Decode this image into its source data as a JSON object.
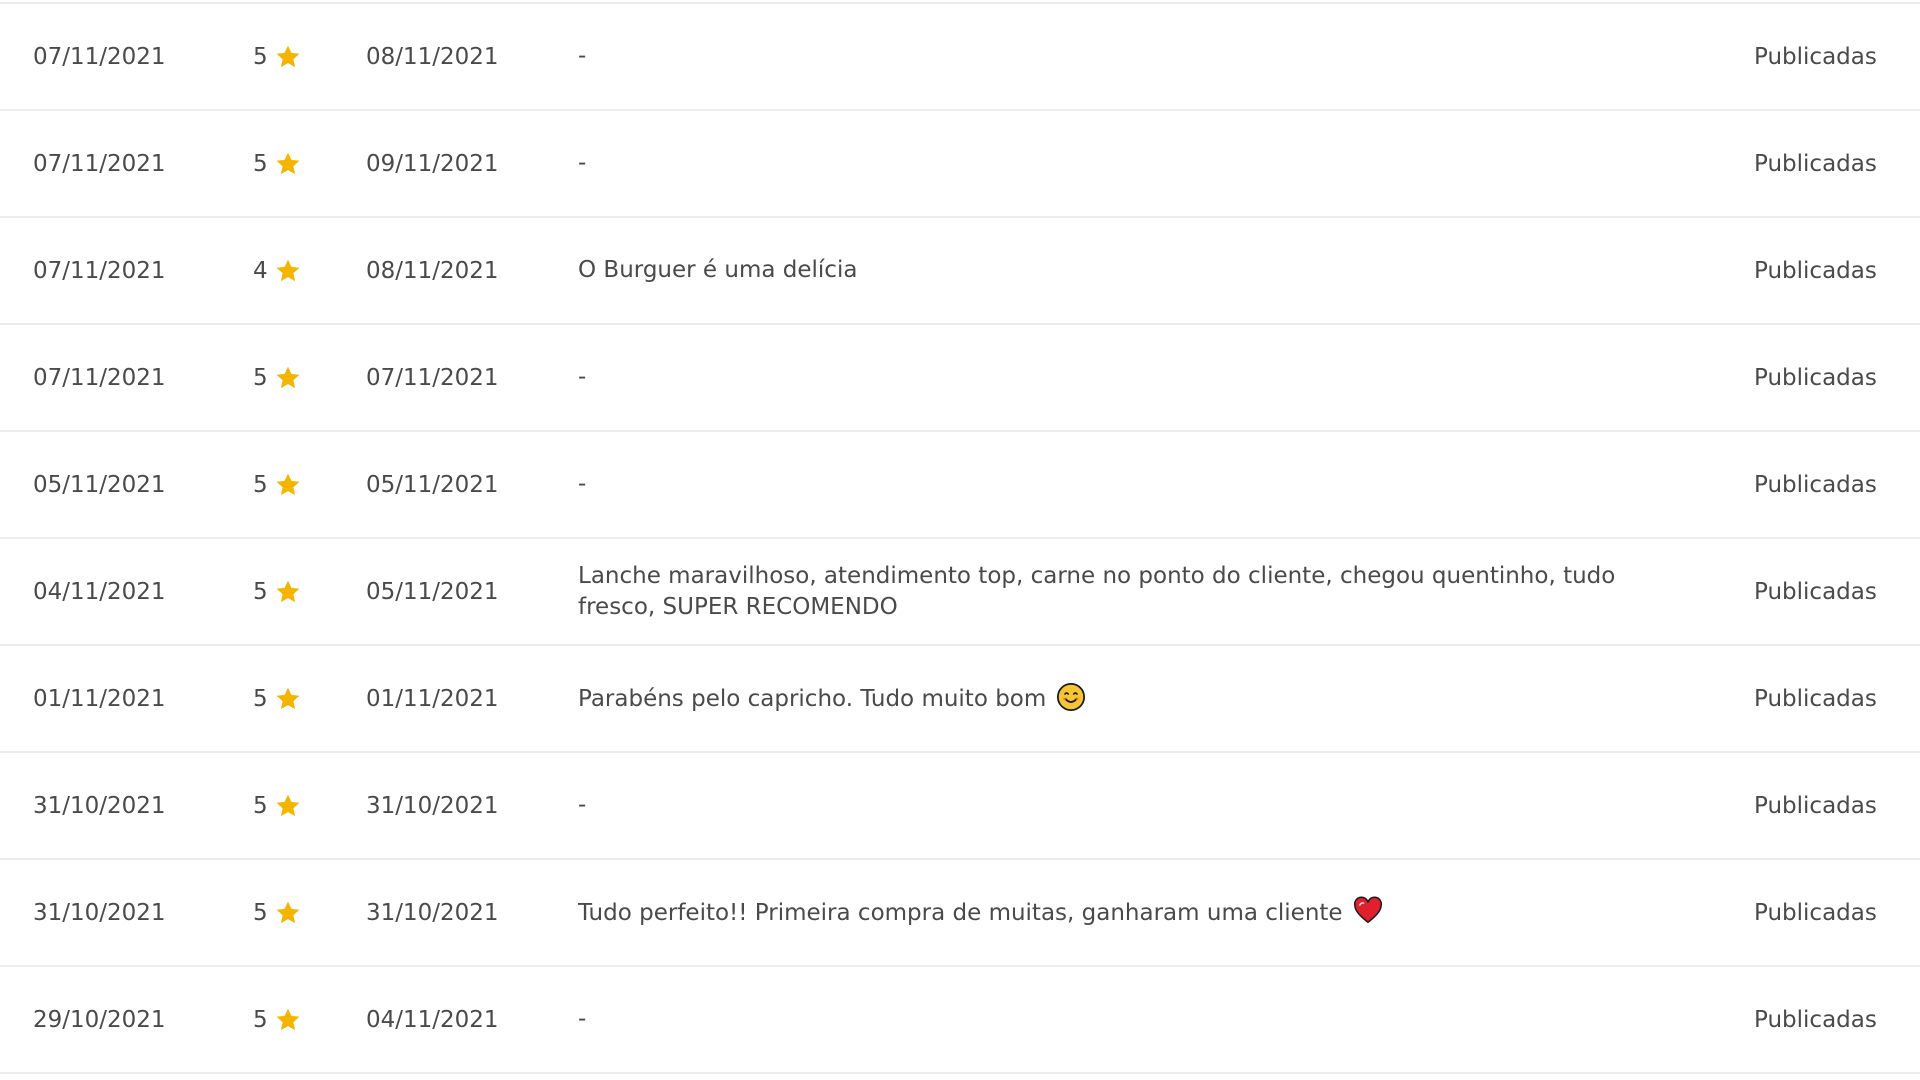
{
  "reviews": [
    {
      "date": "07/11/2021",
      "rating": "5",
      "reply_date": "08/11/2021",
      "comment": "-",
      "status": "Publicadas"
    },
    {
      "date": "07/11/2021",
      "rating": "5",
      "reply_date": "09/11/2021",
      "comment": "-",
      "status": "Publicadas"
    },
    {
      "date": "07/11/2021",
      "rating": "4",
      "reply_date": "08/11/2021",
      "comment": "O Burguer é uma delícia",
      "status": "Publicadas"
    },
    {
      "date": "07/11/2021",
      "rating": "5",
      "reply_date": "07/11/2021",
      "comment": "-",
      "status": "Publicadas"
    },
    {
      "date": "05/11/2021",
      "rating": "5",
      "reply_date": "05/11/2021",
      "comment": "-",
      "status": "Publicadas"
    },
    {
      "date": "04/11/2021",
      "rating": "5",
      "reply_date": "05/11/2021",
      "comment": "Lanche maravilhoso, atendimento top, carne no ponto do cliente, chegou quentinho, tudo fresco, SUPER RECOMENDO",
      "status": "Publicadas"
    },
    {
      "date": "01/11/2021",
      "rating": "5",
      "reply_date": "01/11/2021",
      "comment": "Parabéns pelo capricho. Tudo muito bom",
      "comment_emoji": "smiling-face-icon",
      "status": "Publicadas"
    },
    {
      "date": "31/10/2021",
      "rating": "5",
      "reply_date": "31/10/2021",
      "comment": "-",
      "status": "Publicadas"
    },
    {
      "date": "31/10/2021",
      "rating": "5",
      "reply_date": "31/10/2021",
      "comment": "Tudo perfeito!! Primeira compra de muitas, ganharam uma cliente",
      "comment_emoji": "red-heart-icon",
      "status": "Publicadas"
    },
    {
      "date": "29/10/2021",
      "rating": "5",
      "reply_date": "04/11/2021",
      "comment": "-",
      "status": "Publicadas"
    }
  ],
  "colors": {
    "text": "#4a4a4a",
    "star": "#f5b400",
    "divider": "#ececec",
    "heart": "#e0202c",
    "smile": "#f7c531"
  },
  "icons": {
    "rating": "star-icon"
  }
}
